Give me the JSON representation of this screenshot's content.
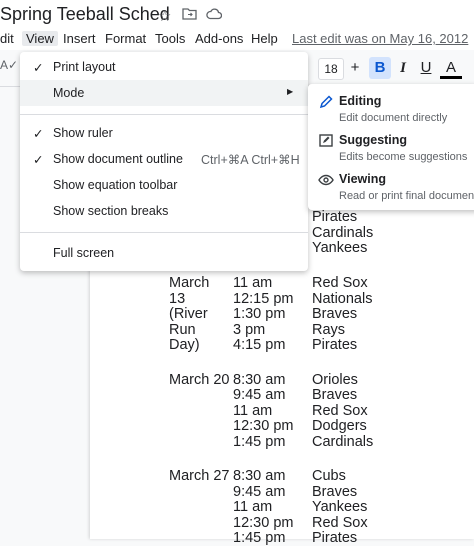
{
  "document": {
    "title": "Spring Teeball Sched",
    "last_edit": "Last edit was on May 16, 2012"
  },
  "menubar": {
    "items": [
      "dit",
      "View",
      "Insert",
      "Format",
      "Tools",
      "Add-ons",
      "Help"
    ]
  },
  "toolbar": {
    "spell_icon": "A✓",
    "font_size": "18",
    "plus": "+",
    "bold": "B",
    "italic": "I",
    "underline": "U",
    "text_color": "A"
  },
  "view_menu": {
    "items": [
      {
        "label": "Print layout",
        "checked": true,
        "shortcut": ""
      },
      {
        "label": "Mode",
        "checked": false,
        "shortcut": "",
        "submenu": true
      },
      {
        "label": "Show ruler",
        "checked": true,
        "shortcut": ""
      },
      {
        "label": "Show document outline",
        "checked": true,
        "shortcut": "Ctrl+⌘A Ctrl+⌘H"
      },
      {
        "label": "Show equation toolbar",
        "checked": false,
        "shortcut": ""
      },
      {
        "label": "Show section breaks",
        "checked": false,
        "shortcut": ""
      },
      {
        "label": "Full screen",
        "checked": false,
        "shortcut": ""
      }
    ]
  },
  "mode_submenu": {
    "options": [
      {
        "name": "Editing",
        "description": "Edit document directly",
        "icon": "pencil-icon"
      },
      {
        "name": "Suggesting",
        "description": "Edits become suggestions",
        "icon": "suggest-icon"
      },
      {
        "name": "Viewing",
        "description": "Read or print final document",
        "icon": "eye-icon"
      }
    ]
  },
  "schedule": [
    {
      "date": "",
      "time": "",
      "team": "Pirates"
    },
    {
      "date": "",
      "time": "",
      "team": "Cardinals"
    },
    {
      "date": "",
      "time": "",
      "team": "Yankees"
    },
    {
      "date": "March",
      "time": "11 am",
      "team": "Red Sox"
    },
    {
      "date": "13",
      "time": "12:15 pm",
      "team": "Nationals"
    },
    {
      "date": "(River",
      "time": "1:30 pm",
      "team": "Braves"
    },
    {
      "date": "Run",
      "time": "3 pm",
      "team": "Rays"
    },
    {
      "date": "Day)",
      "time": "4:15 pm",
      "team": "Pirates"
    },
    {
      "date": "March 20",
      "time": "8:30 am",
      "team": "Orioles"
    },
    {
      "date": "",
      "time": "9:45 am",
      "team": "Braves"
    },
    {
      "date": "",
      "time": "11 am",
      "team": "Red Sox"
    },
    {
      "date": "",
      "time": "12:30 pm",
      "team": "Dodgers"
    },
    {
      "date": "",
      "time": "1:45 pm",
      "team": "Cardinals"
    },
    {
      "date": "March 27",
      "time": "8:30 am",
      "team": "Cubs"
    },
    {
      "date": "",
      "time": "9:45 am",
      "team": "Braves"
    },
    {
      "date": "",
      "time": "11 am",
      "team": "Yankees"
    },
    {
      "date": "",
      "time": "12:30 pm",
      "team": "Red Sox"
    },
    {
      "date": "",
      "time": "1:45 pm",
      "team": "Pirates"
    }
  ],
  "colors": {
    "accent": "#0b57d0",
    "menu_hover": "#f1f3f4"
  }
}
